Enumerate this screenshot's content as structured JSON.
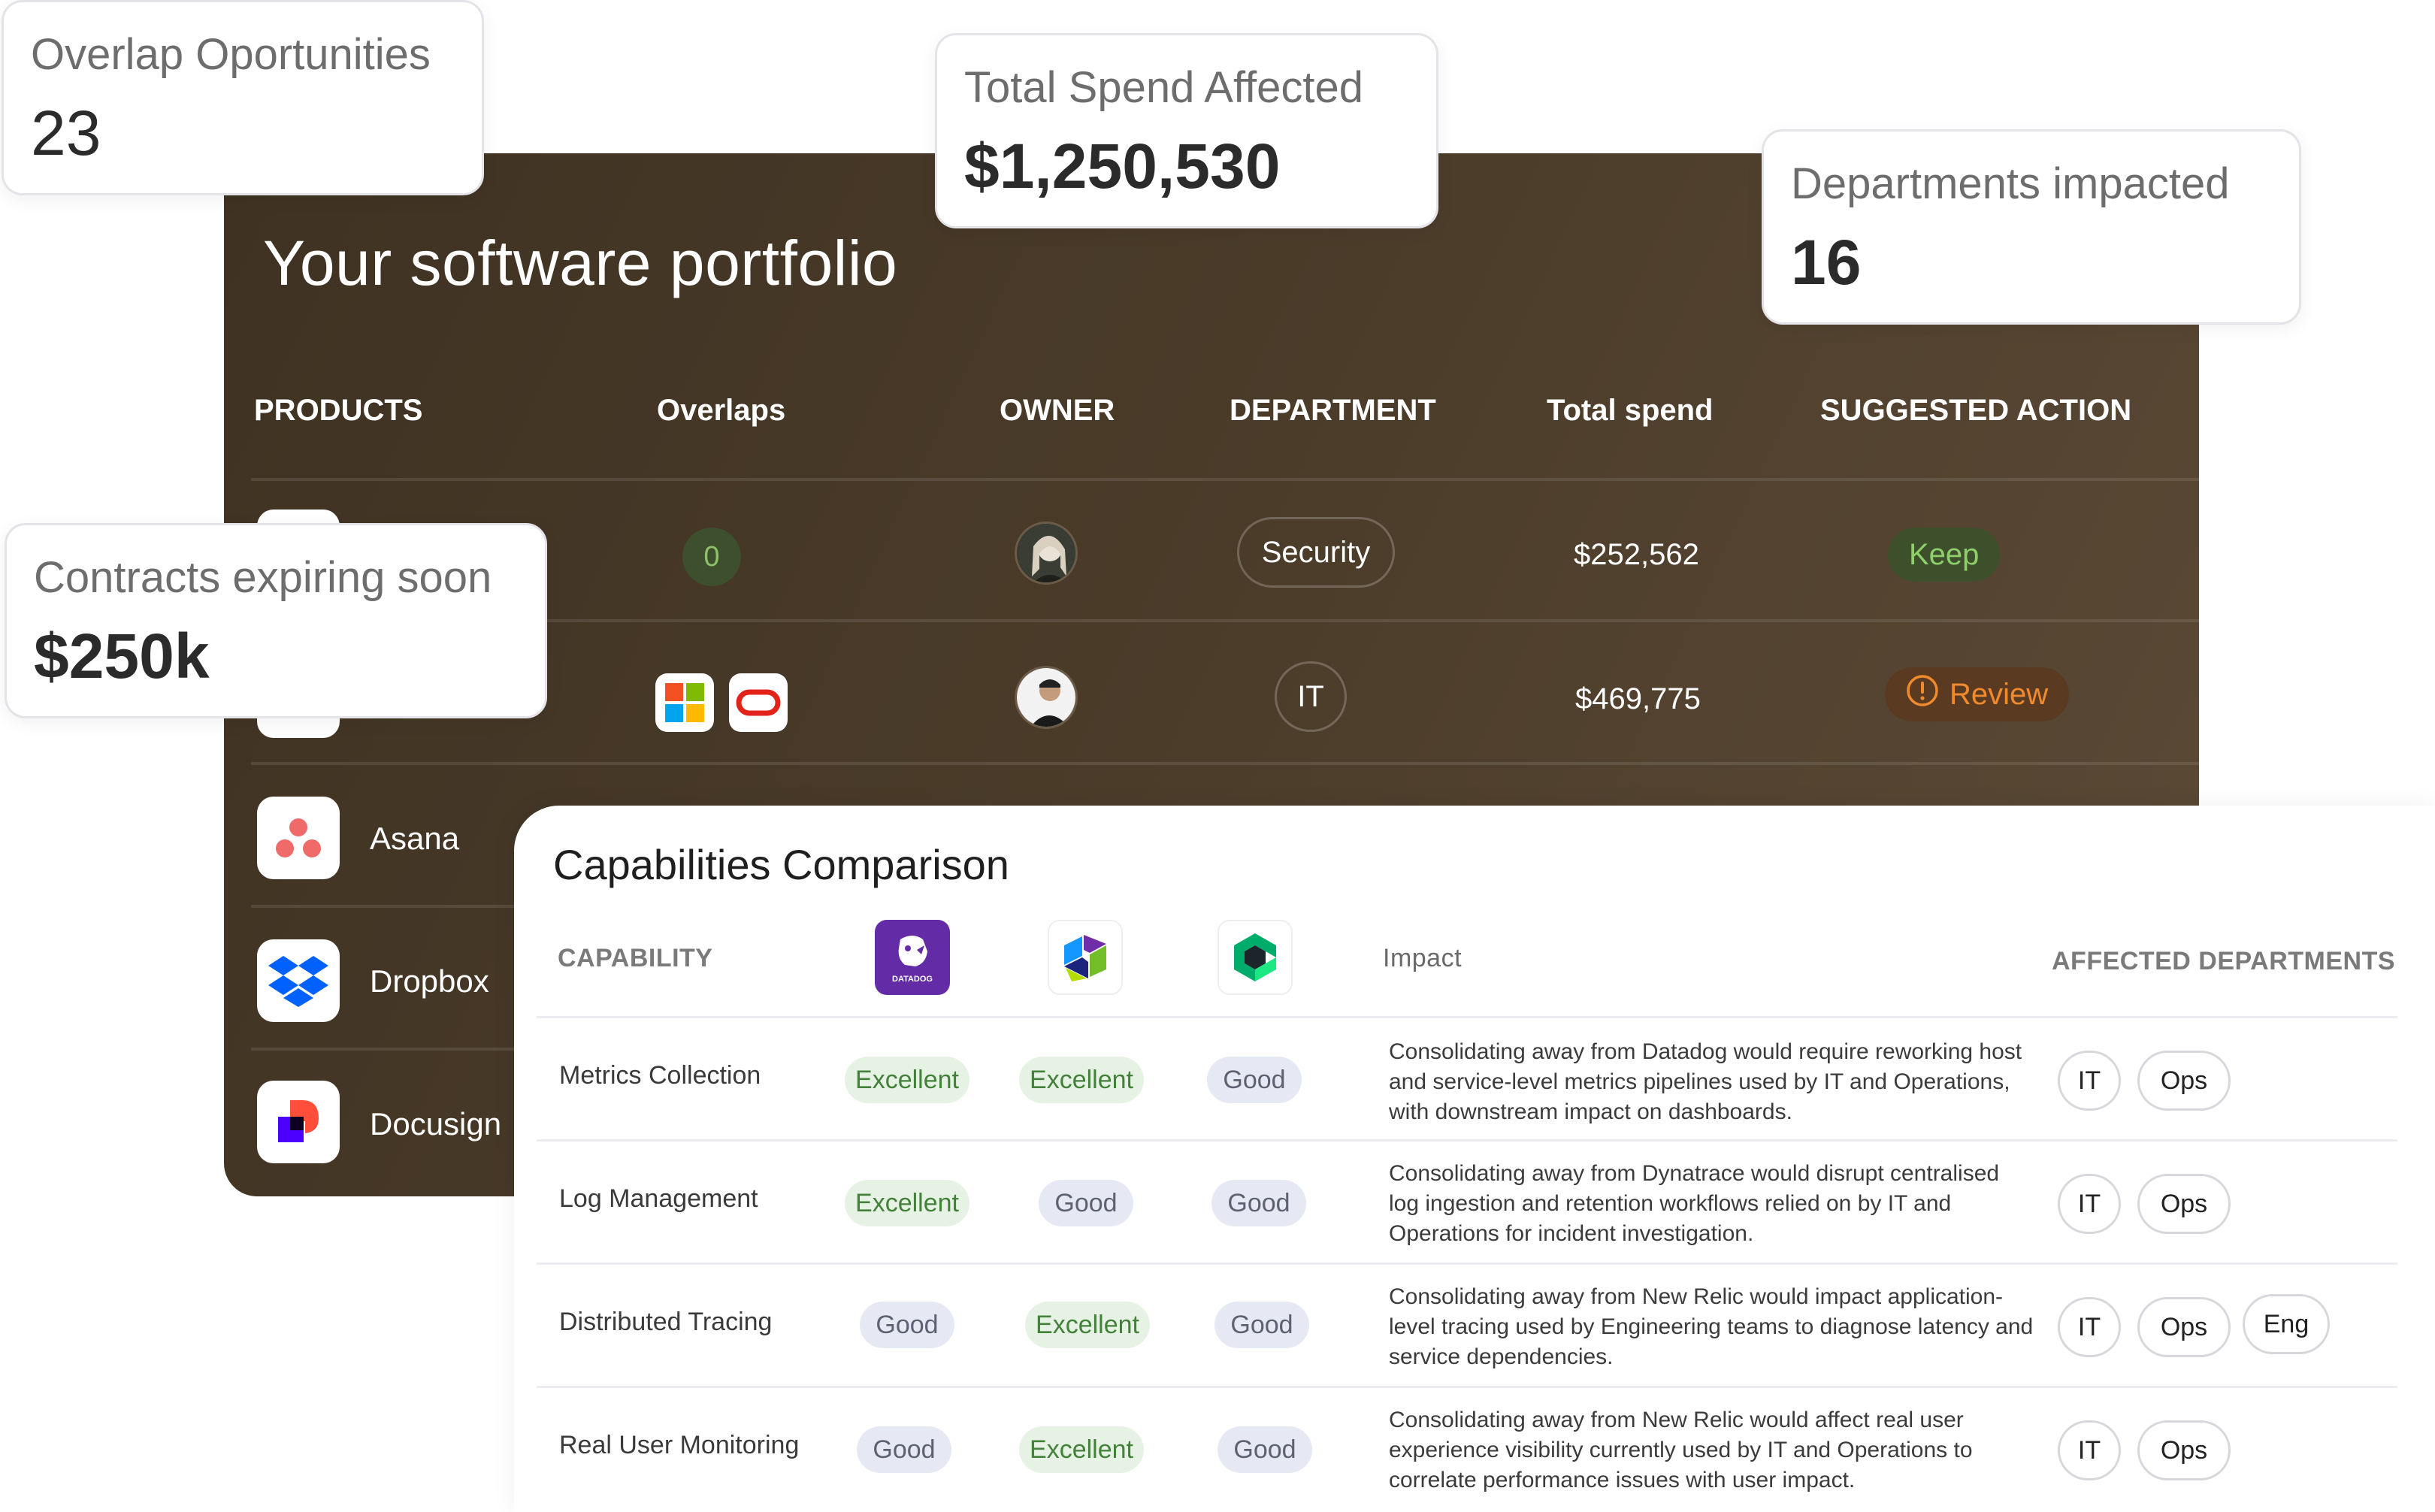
{
  "stats": {
    "overlap": {
      "label": "Overlap Oportunities",
      "value": "23"
    },
    "total_spend": {
      "label": "Total Spend Affected",
      "value": "$1,250,530"
    },
    "departments": {
      "label": "Departments impacted",
      "value": "16"
    },
    "contracts": {
      "label": "Contracts expiring soon",
      "value": "$250k"
    }
  },
  "portfolio": {
    "title": "Your software portfolio",
    "columns": [
      "PRODUCTS",
      "Overlaps",
      "OWNER",
      "DEPARTMENT",
      "Total spend",
      "SUGGESTED ACTION"
    ],
    "rows": [
      {
        "overlaps": "0",
        "department": "Security",
        "spend": "$252,562",
        "action": "Keep",
        "action_type": "keep"
      },
      {
        "overlaps_logos": [
          "microsoft-icon",
          "oracle-icon"
        ],
        "department": "IT",
        "spend": "$469,775",
        "action": "Review",
        "action_type": "review"
      }
    ],
    "apps": [
      {
        "name": "Asana",
        "icon": "asana-icon"
      },
      {
        "name": "Dropbox",
        "icon": "dropbox-icon"
      },
      {
        "name": "Docusign",
        "icon": "docusign-icon"
      }
    ]
  },
  "capabilities": {
    "title": "Capabilities Comparison",
    "headers": {
      "capability": "CAPABILITY",
      "impact": "Impact",
      "departments": "AFFECTED DEPARTMENTS"
    },
    "vendors": [
      {
        "icon": "datadog-icon",
        "label": "DATADOG"
      },
      {
        "icon": "dynatrace-icon"
      },
      {
        "icon": "newrelic-icon"
      }
    ],
    "rows": [
      {
        "name": "Metrics Collection",
        "ratings": [
          "Excellent",
          "Excellent",
          "Good"
        ],
        "impact": "Consolidating away from Datadog would require reworking host and service-level metrics pipelines used by IT and Operations, with downstream impact on dashboards.",
        "departments": [
          "IT",
          "Ops"
        ]
      },
      {
        "name": "Log Management",
        "ratings": [
          "Excellent",
          "Good",
          "Good"
        ],
        "impact": "Consolidating away from Dynatrace would disrupt centralised log ingestion and retention workflows relied on by IT and Operations for incident investigation.",
        "departments": [
          "IT",
          "Ops"
        ]
      },
      {
        "name": "Distributed Tracing",
        "ratings": [
          "Good",
          "Excellent",
          "Good"
        ],
        "impact": "Consolidating away from New Relic would impact application-level tracing used by Engineering teams to diagnose latency and service dependencies.",
        "departments": [
          "IT",
          "Ops",
          "Eng"
        ]
      },
      {
        "name": "Real User Monitoring",
        "ratings": [
          "Good",
          "Excellent",
          "Good"
        ],
        "impact": "Consolidating away from New Relic would affect real user experience visibility currently used by IT and Operations to correlate performance issues with user impact.",
        "departments": [
          "IT",
          "Ops"
        ]
      }
    ]
  },
  "colors": {
    "panel_bg": "#4a3b29",
    "excellent_bg": "#e6f3e4",
    "excellent_fg": "#43803a",
    "good_bg": "#e6e9f3",
    "keep_fg": "#8fcf6b",
    "review_fg": "#f08a2c"
  }
}
